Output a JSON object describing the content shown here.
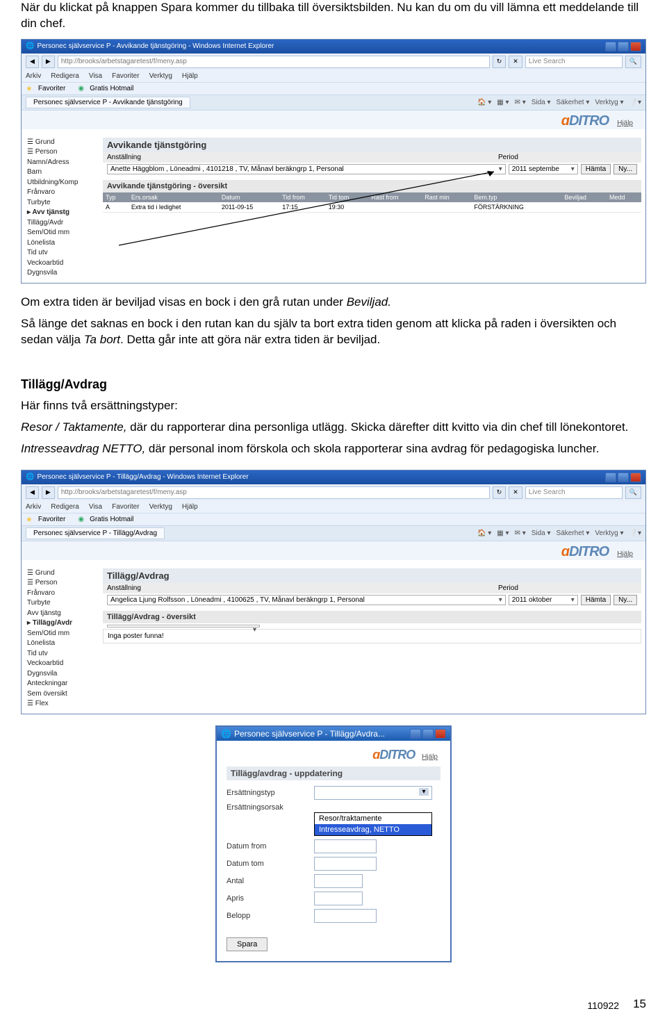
{
  "intro_para": "När du klickat på knappen Spara kommer du tillbaka till översiktsbilden. Nu kan du om du vill lämna ett meddelande till din chef.",
  "shot1": {
    "title": "Personec självservice P - Avvikande tjänstgöring - Windows Internet Explorer",
    "url": "http://brooks/arbetstagaretest/f/meny.asp",
    "search_placeholder": "Live Search",
    "menus": [
      "Arkiv",
      "Redigera",
      "Visa",
      "Favoriter",
      "Verktyg",
      "Hjälp"
    ],
    "fav_label": "Favoriter",
    "fav_item": "Gratis Hotmail",
    "tab": "Personec självservice P - Avvikande tjänstgöring",
    "toolbar_items": [
      "Sida ▾",
      "Säkerhet ▾",
      "Verktyg ▾"
    ],
    "logo_text_a": "ɑ",
    "logo_rest": "DITRO",
    "hjalp": "Hjälp",
    "sidebar": [
      "☰ Grund",
      "☰ Person",
      "  Namn/Adress",
      "  Barn",
      "  Utbildning/Komp",
      "  Frånvaro",
      "  Turbyte",
      "▸ Avv tjänstg",
      "  Tillägg/Avdr",
      "  Sem/Otid mm",
      "  Lönelista",
      "  Tid utv",
      "  Veckoarbtid",
      "  Dygnsvila"
    ],
    "section_title": "Avvikande tjänstgöring",
    "col_left": "Anställning",
    "col_right": "Period",
    "anst": "Anette Häggblom , Löneadmi , 4101218 , TV, Månavl beräkngrp 1, Personal",
    "period": "2011 septembe",
    "btn_hamta": "Hämta",
    "btn_ny": "Ny...",
    "oversikt_title": "Avvikande tjänstgöring - översikt",
    "headers": [
      "Typ",
      "Ers.orsak",
      "Datum",
      "Tid from",
      "Tid tom",
      "Rast from",
      "Rast min",
      "Bem.typ",
      "Beviljad",
      "Medd"
    ],
    "row": [
      "A",
      "Extra tid i ledighet",
      "2011-09-15",
      "17:15",
      "19:30",
      "",
      "",
      "FÖRSTÄRKNING",
      "",
      ""
    ]
  },
  "mid_para1_pre": "Om extra tiden är beviljad visas en bock i den grå rutan under ",
  "mid_para1_it": "Beviljad.",
  "mid_para2_pre": "Så länge det saknas en bock i den rutan kan du själv ta bort extra tiden genom att klicka på raden i översikten och sedan välja ",
  "mid_para2_it": "Ta bort",
  "mid_para2_post": ". Detta går inte att göra när extra tiden är beviljad.",
  "section_title2": "Tillägg/Avdrag",
  "line1": "Här finns två ersättningstyper:",
  "line2_it": "Resor / Taktamente,",
  "line2_post": " där du rapporterar dina personliga utlägg. Skicka därefter ditt kvitto via din chef till lönekontoret.",
  "line3_it": "Intresseavdrag NETTO,",
  "line3_post": " där personal inom förskola och skola rapporterar sina avdrag för pedagogiska luncher.",
  "shot2": {
    "title": "Personec självservice P - Tillägg/Avdrag - Windows Internet Explorer",
    "tab": "Personec självservice P - Tillägg/Avdrag",
    "sidebar": [
      "☰ Grund",
      "☰ Person",
      "  Frånvaro",
      "  Turbyte",
      "  Avv tjänstg",
      "▸ Tillägg/Avdr",
      "  Sem/Otid mm",
      "  Lönelista",
      "  Tid utv",
      "  Veckoarbtid",
      "  Dygnsvila",
      "  Anteckningar",
      "  Sem översikt",
      "☰ Flex"
    ],
    "section_title": "Tillägg/Avdrag",
    "anst": "Angelica Ljung Rolfsson , Löneadmi , 4100625 , TV, Månavl beräkngrp 1, Personal",
    "period": "2011 oktober",
    "oversikt_title": "Tillägg/Avdrag - översikt",
    "no_rows": "Inga poster funna!"
  },
  "popup": {
    "title": "Personec självservice P - Tillägg/Avdra...",
    "hjalp": "Hjälp",
    "section": "Tillägg/avdrag - uppdatering",
    "fields": [
      "Ersättningstyp",
      "Ersättningsorsak",
      "Datum from",
      "Datum tom",
      "Antal",
      "Apris",
      "Belopp"
    ],
    "opt1": "Resor/traktamente",
    "opt2": "Intresseavdrag, NETTO",
    "save": "Spara"
  },
  "footer_date": "110922",
  "footer_page": "15"
}
